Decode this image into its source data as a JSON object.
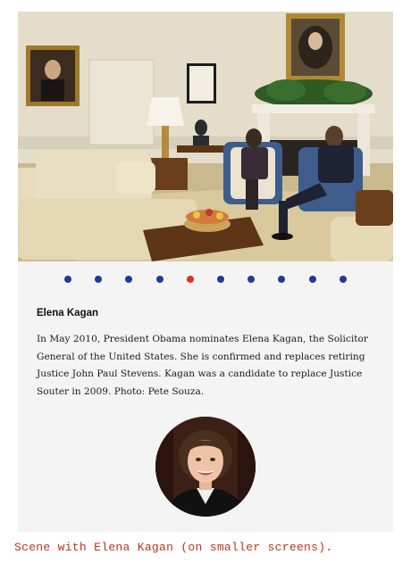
{
  "slideshow": {
    "photo_icon": "oval-office-photo",
    "pagination": {
      "count": 10,
      "active_index": 4,
      "active_color": "#e0321c",
      "inactive_color": "#1f3a9a"
    },
    "slide": {
      "title": "Elena Kagan",
      "text": "In May 2010, President Obama nominates Elena Kagan, the Solicitor General of the United States. She is confirmed and replaces retiring Justice John Paul Stevens. Kagan was a candidate to replace Justice Souter in 2009. Photo: Pete Souza.",
      "portrait_icon": "elena-kagan-portrait"
    }
  },
  "caption": "Scene with Elena Kagan (on smaller screens)."
}
